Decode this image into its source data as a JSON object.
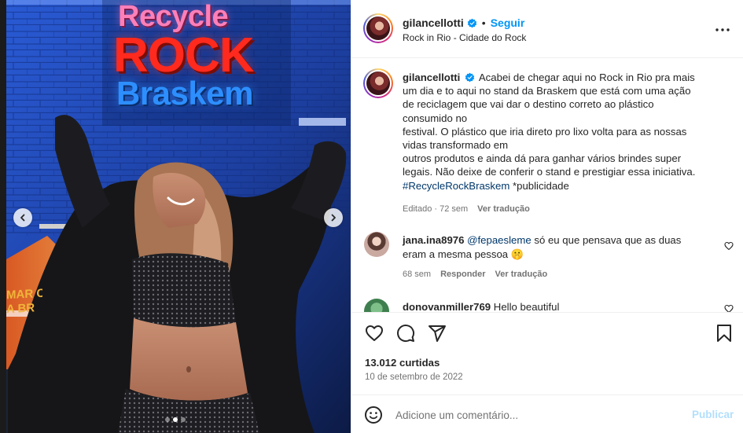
{
  "media": {
    "sign": {
      "line1": "Recycle",
      "line2": "ROCK",
      "line3": "Braskem"
    },
    "background_text": "MAR C\nA BR",
    "slide_count": 3,
    "active_slide_index": 1
  },
  "header": {
    "username": "gilancellotti",
    "separator": "•",
    "follow_label": "Seguir",
    "location": "Rock in Rio - Cidade do Rock"
  },
  "caption": {
    "username": "gilancellotti",
    "lines": [
      "Acabei de chegar aqui no Rock in Rio pra mais",
      "um dia e to aqui no stand da Braskem que está com uma ação",
      "de reciclagem que vai dar o destino correto ao plástico",
      "consumido no",
      "festival. O plástico que iria direto pro lixo volta para as nossas",
      "vidas transformado em",
      "outros produtos e ainda dá para ganhar vários brindes super",
      "legais. Não deixe de conferir o stand e prestigiar essa iniciativa."
    ],
    "hashtag": "#RecycleRockBraskem",
    "hashtag_suffix": " *publicidade",
    "edited": "Editado · 72 sem",
    "see_translation": "Ver tradução"
  },
  "comments": [
    {
      "username": "jana.ina8976",
      "mention": "@fepaesleme",
      "text_line1": " só eu que pensava que as duas",
      "text_line2": "eram a mesma pessoa 🤫",
      "time": "68 sem",
      "reply": "Responder",
      "see_translation": "Ver tradução"
    },
    {
      "username": "donovanmiller769",
      "text": " Hello beautiful"
    }
  ],
  "actions": {
    "likes": "13.012 curtidas",
    "date": "10 de setembro de 2022"
  },
  "comment_box": {
    "placeholder": "Adicione um comentário...",
    "post_label": "Publicar"
  },
  "colors": {
    "link_blue": "#0095f6",
    "hashtag_blue": "#00376b",
    "muted": "#737373",
    "post_disabled": "#b2dffc"
  }
}
